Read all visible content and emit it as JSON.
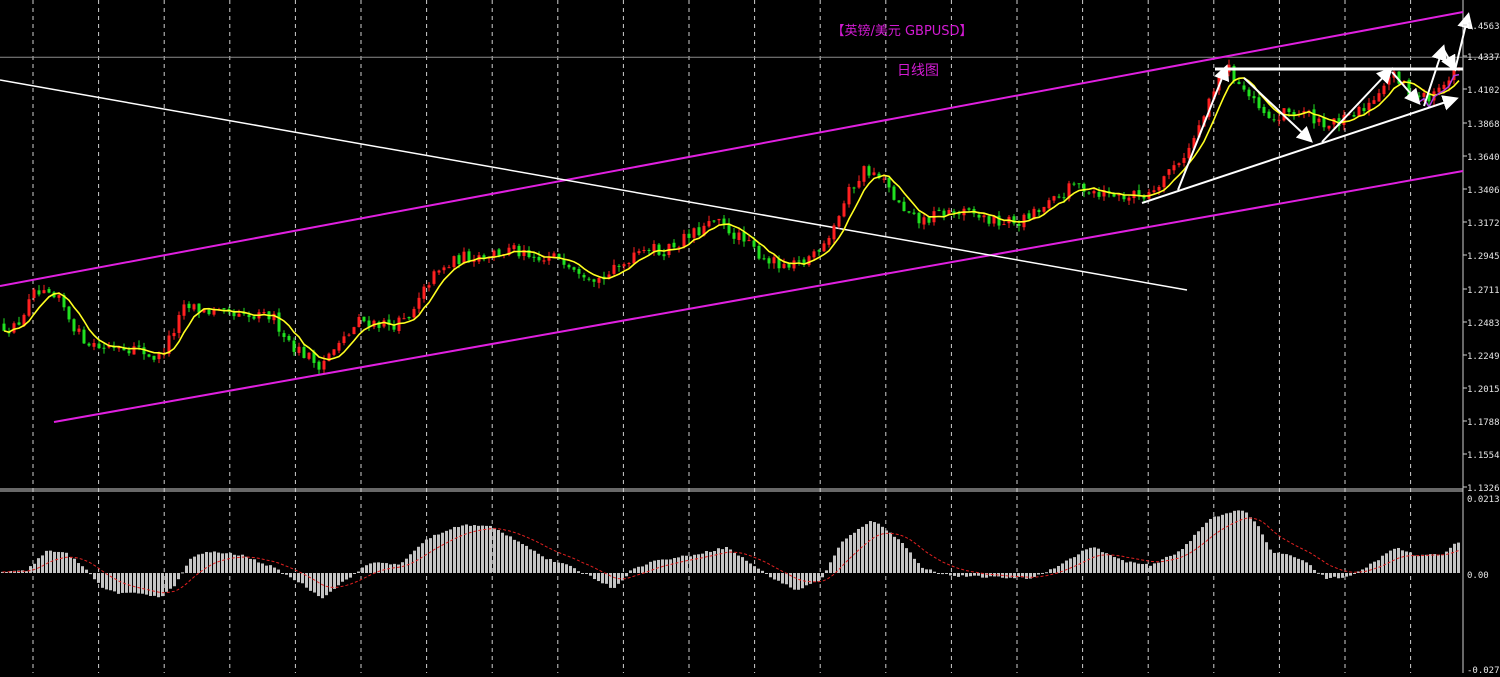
{
  "chart_data": {
    "type": "candlestick",
    "title": "【英镑/美元 GBPUSD】",
    "subtitle": "日线图",
    "price_panel": {
      "y_ticks": [
        "1.45635",
        "1.43372",
        "1.41020",
        "1.38680",
        "1.36405",
        "1.34065",
        "1.31725",
        "1.29450",
        "1.27110",
        "1.24835",
        "1.22495",
        "1.20155",
        "1.17880",
        "1.15540",
        "1.13265"
      ],
      "current_price": 1.4337,
      "ylim": [
        1.13265,
        1.45635
      ],
      "price_path": [
        [
          0,
          1.246
        ],
        [
          15,
          1.243
        ],
        [
          35,
          1.268
        ],
        [
          60,
          1.262
        ],
        [
          80,
          1.238
        ],
        [
          100,
          1.23
        ],
        [
          120,
          1.232
        ],
        [
          140,
          1.228
        ],
        [
          158,
          1.222
        ],
        [
          170,
          1.236
        ],
        [
          185,
          1.258
        ],
        [
          205,
          1.256
        ],
        [
          225,
          1.252
        ],
        [
          250,
          1.25
        ],
        [
          272,
          1.252
        ],
        [
          292,
          1.232
        ],
        [
          318,
          1.218
        ],
        [
          335,
          1.228
        ],
        [
          360,
          1.249
        ],
        [
          390,
          1.246
        ],
        [
          410,
          1.249
        ],
        [
          430,
          1.278
        ],
        [
          460,
          1.293
        ],
        [
          490,
          1.296
        ],
        [
          515,
          1.298
        ],
        [
          535,
          1.289
        ],
        [
          560,
          1.294
        ],
        [
          580,
          1.285
        ],
        [
          600,
          1.278
        ],
        [
          620,
          1.286
        ],
        [
          640,
          1.302
        ],
        [
          660,
          1.297
        ],
        [
          690,
          1.308
        ],
        [
          715,
          1.318
        ],
        [
          730,
          1.312
        ],
        [
          755,
          1.298
        ],
        [
          785,
          1.284
        ],
        [
          805,
          1.29
        ],
        [
          830,
          1.31
        ],
        [
          850,
          1.34
        ],
        [
          865,
          1.356
        ],
        [
          885,
          1.345
        ],
        [
          905,
          1.323
        ],
        [
          920,
          1.318
        ],
        [
          945,
          1.325
        ],
        [
          975,
          1.323
        ],
        [
          995,
          1.318
        ],
        [
          1020,
          1.318
        ],
        [
          1045,
          1.328
        ],
        [
          1075,
          1.344
        ],
        [
          1100,
          1.339
        ],
        [
          1125,
          1.336
        ],
        [
          1145,
          1.337
        ],
        [
          1165,
          1.351
        ],
        [
          1190,
          1.37
        ],
        [
          1210,
          1.402
        ],
        [
          1225,
          1.428
        ],
        [
          1240,
          1.415
        ],
        [
          1255,
          1.4
        ],
        [
          1270,
          1.388
        ],
        [
          1290,
          1.396
        ],
        [
          1310,
          1.393
        ],
        [
          1330,
          1.386
        ],
        [
          1350,
          1.39
        ],
        [
          1370,
          1.402
        ],
        [
          1390,
          1.422
        ],
        [
          1410,
          1.41
        ],
        [
          1430,
          1.404
        ],
        [
          1445,
          1.416
        ],
        [
          1455,
          1.425
        ]
      ]
    },
    "macd_panel": {
      "y_ticks": [
        "0.02130",
        "0.00",
        "-0.0273"
      ],
      "ylim": [
        -0.0273,
        0.0213
      ],
      "histogram_path": [
        [
          0,
          0.0002
        ],
        [
          25,
          0.0006
        ],
        [
          45,
          0.0062
        ],
        [
          65,
          0.0055
        ],
        [
          85,
          0.0012
        ],
        [
          100,
          -0.0042
        ],
        [
          120,
          -0.006
        ],
        [
          140,
          -0.0058
        ],
        [
          160,
          -0.007
        ],
        [
          175,
          -0.003
        ],
        [
          190,
          0.0045
        ],
        [
          210,
          0.006
        ],
        [
          240,
          0.005
        ],
        [
          270,
          0.0018
        ],
        [
          300,
          -0.003
        ],
        [
          320,
          -0.0072
        ],
        [
          345,
          -0.0018
        ],
        [
          370,
          0.003
        ],
        [
          400,
          0.0025
        ],
        [
          425,
          0.0095
        ],
        [
          460,
          0.0135
        ],
        [
          490,
          0.013
        ],
        [
          520,
          0.0085
        ],
        [
          545,
          0.004
        ],
        [
          565,
          0.0022
        ],
        [
          590,
          -0.001
        ],
        [
          612,
          -0.0045
        ],
        [
          630,
          0.0008
        ],
        [
          650,
          0.0032
        ],
        [
          690,
          0.005
        ],
        [
          725,
          0.0072
        ],
        [
          745,
          0.0035
        ],
        [
          770,
          -0.0012
        ],
        [
          795,
          -0.005
        ],
        [
          820,
          -0.0018
        ],
        [
          840,
          0.0085
        ],
        [
          870,
          0.015
        ],
        [
          900,
          0.009
        ],
        [
          920,
          0.0015
        ],
        [
          950,
          -0.0008
        ],
        [
          990,
          -0.0012
        ],
        [
          1030,
          -0.0015
        ],
        [
          1060,
          0.0025
        ],
        [
          1090,
          0.0075
        ],
        [
          1120,
          0.0035
        ],
        [
          1150,
          0.002
        ],
        [
          1180,
          0.0065
        ],
        [
          1210,
          0.0155
        ],
        [
          1240,
          0.018
        ],
        [
          1255,
          0.014
        ],
        [
          1270,
          0.006
        ],
        [
          1300,
          0.004
        ],
        [
          1325,
          -0.0015
        ],
        [
          1350,
          -0.001
        ],
        [
          1375,
          0.0035
        ],
        [
          1395,
          0.0072
        ],
        [
          1415,
          0.0048
        ],
        [
          1440,
          0.0052
        ],
        [
          1455,
          0.0085
        ]
      ]
    }
  }
}
